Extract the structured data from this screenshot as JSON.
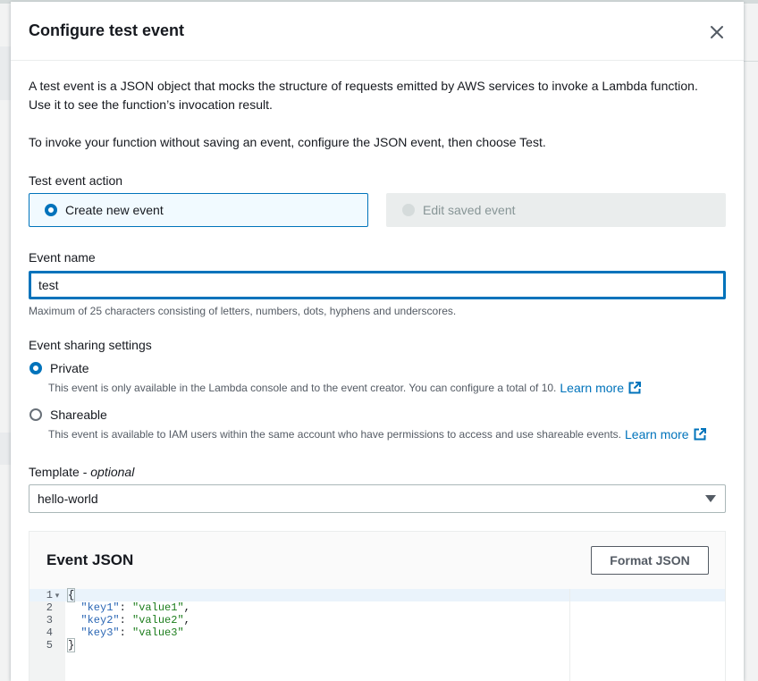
{
  "modal": {
    "title": "Configure test event",
    "intro_line1": "A test event is a JSON object that mocks the structure of requests emitted by AWS services to invoke a Lambda function.",
    "intro_line2": "Use it to see the function’s invocation result.",
    "intro_line3": "To invoke your function without saving an event, configure the JSON event, then choose Test."
  },
  "test_event_action": {
    "label": "Test event action",
    "options": [
      {
        "label": "Create new event",
        "selected": true,
        "disabled": false
      },
      {
        "label": "Edit saved event",
        "selected": false,
        "disabled": true
      }
    ]
  },
  "event_name": {
    "label": "Event name",
    "value": "test",
    "hint": "Maximum of 25 characters consisting of letters, numbers, dots, hyphens and underscores."
  },
  "sharing": {
    "label": "Event sharing settings",
    "private": {
      "label": "Private",
      "selected": true,
      "description": "This event is only available in the Lambda console and to the event creator. You can configure a total of 10.",
      "link": "Learn more"
    },
    "shareable": {
      "label": "Shareable",
      "selected": false,
      "description": "This event is available to IAM users within the same account who have permissions to access and use shareable events.",
      "link": "Learn more"
    }
  },
  "template": {
    "label": "Template",
    "optional": "optional",
    "selected": "hello-world"
  },
  "event_json": {
    "title": "Event JSON",
    "format_button": "Format JSON",
    "lines": [
      {
        "num": "1",
        "fold": "▾",
        "tokens": [
          [
            "p",
            "{"
          ]
        ]
      },
      {
        "num": "2",
        "fold": "",
        "tokens": [
          [
            "p",
            "  "
          ],
          [
            "k",
            "\"key1\""
          ],
          [
            "p",
            ": "
          ],
          [
            "s",
            "\"value1\""
          ],
          [
            "p",
            ","
          ]
        ]
      },
      {
        "num": "3",
        "fold": "",
        "tokens": [
          [
            "p",
            "  "
          ],
          [
            "k",
            "\"key2\""
          ],
          [
            "p",
            ": "
          ],
          [
            "s",
            "\"value2\""
          ],
          [
            "p",
            ","
          ]
        ]
      },
      {
        "num": "4",
        "fold": "",
        "tokens": [
          [
            "p",
            "  "
          ],
          [
            "k",
            "\"key3\""
          ],
          [
            "p",
            ": "
          ],
          [
            "s",
            "\"value3\""
          ]
        ]
      },
      {
        "num": "5",
        "fold": "",
        "tokens": [
          [
            "p",
            "}"
          ]
        ]
      }
    ]
  },
  "colors": {
    "accent": "#0073bb",
    "string": "#1c7d1c",
    "key": "#2a66b4"
  }
}
